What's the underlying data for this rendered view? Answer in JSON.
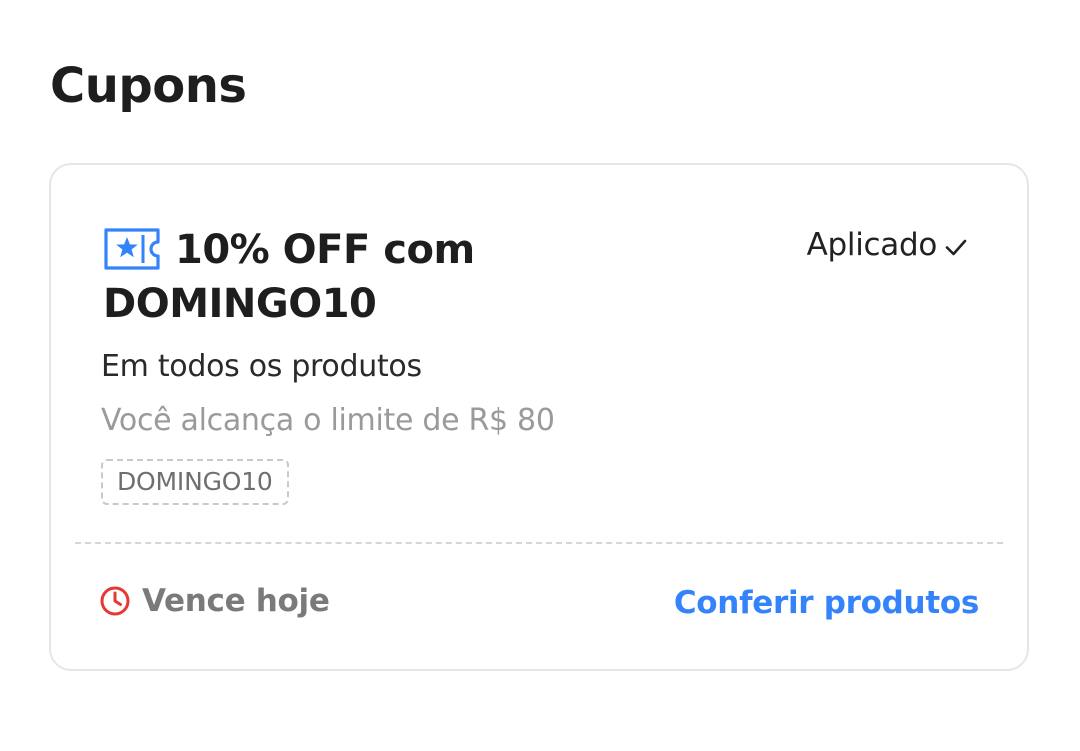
{
  "page": {
    "title": "Cupons"
  },
  "coupon": {
    "title": "10% OFF com DOMINGO10",
    "status": "Aplicado",
    "description": "Em todos os produtos",
    "limit": "Você alcança o limite de R$ 80",
    "code": "DOMINGO10",
    "expiry": "Vence hoje",
    "link": "Conferir produtos"
  },
  "colors": {
    "accent": "#3483fa",
    "expiry_icon": "#e53935",
    "border": "#e6e6e6"
  },
  "icons": {
    "coupon": "ticket-star-icon",
    "status": "check-icon",
    "expiry": "clock-icon"
  }
}
